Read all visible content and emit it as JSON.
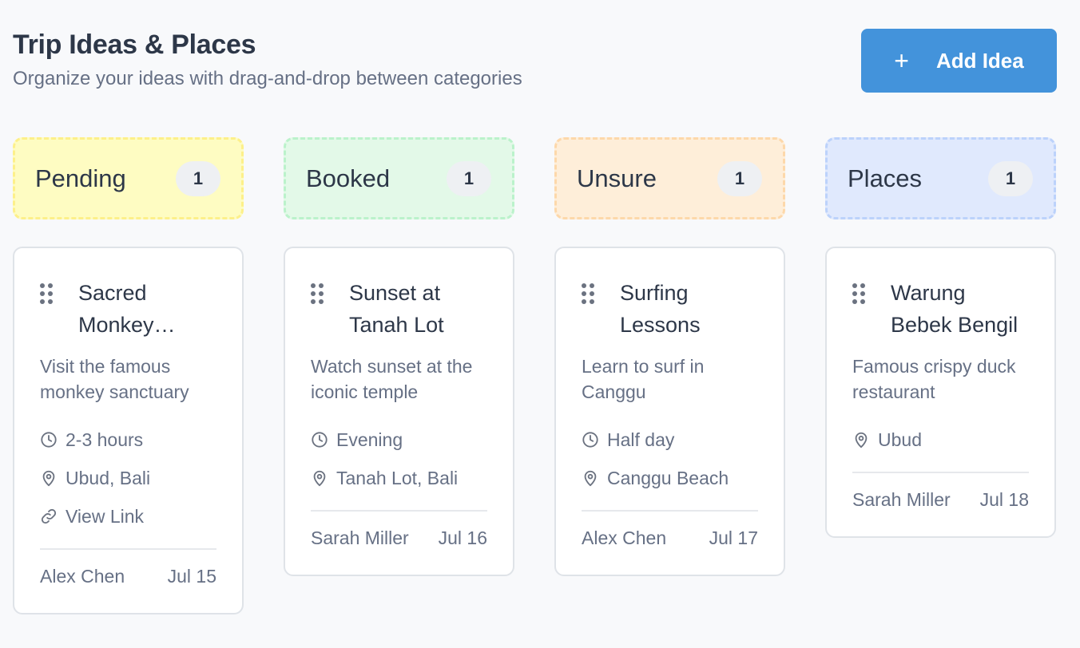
{
  "header": {
    "title": "Trip Ideas & Places",
    "subtitle": "Organize your ideas with drag-and-drop between categories",
    "add_button": {
      "icon": "plus-icon",
      "label": "Add Idea"
    }
  },
  "colors": {
    "accent": "#4393db",
    "pending_bg": "#fefcc2",
    "pending_border": "#fdf08a",
    "booked_bg": "#e3f9e8",
    "booked_border": "#bbf2cb",
    "unsure_bg": "#feeed9",
    "unsure_border": "#fdd8aa",
    "places_bg": "#e0e9fd",
    "places_border": "#bcd2fb"
  },
  "columns": [
    {
      "title": "Pending",
      "count": "1",
      "card": {
        "title": "Sacred Monkey Forest Sanctuary",
        "description": "Visit the famous monkey sanctuary",
        "duration": "2-3 hours",
        "location": "Ubud, Bali",
        "link": "View Link",
        "author": "Alex Chen",
        "date": "Jul 15"
      }
    },
    {
      "title": "Booked",
      "count": "1",
      "card": {
        "title": "Sunset at Tanah Lot",
        "description": "Watch sunset at the iconic temple",
        "duration": "Evening",
        "location": "Tanah Lot, Bali",
        "author": "Sarah Miller",
        "date": "Jul 16"
      }
    },
    {
      "title": "Unsure",
      "count": "1",
      "card": {
        "title": "Surfing Lessons",
        "description": "Learn to surf in Canggu",
        "duration": "Half day",
        "location": "Canggu Beach",
        "author": "Alex Chen",
        "date": "Jul 17"
      }
    },
    {
      "title": "Places",
      "count": "1",
      "card": {
        "title": "Warung Bebek Bengil",
        "description": "Famous crispy duck restaurant",
        "location": "Ubud",
        "author": "Sarah Miller",
        "date": "Jul 18"
      }
    }
  ]
}
